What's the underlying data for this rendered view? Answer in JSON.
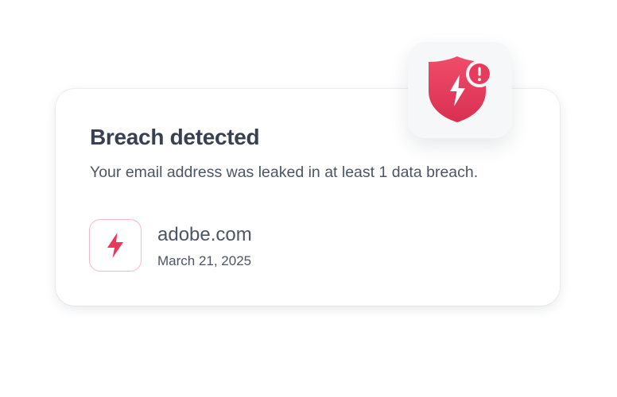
{
  "alert": {
    "title": "Breach detected",
    "message": "Your email address was leaked in at least 1 data breach."
  },
  "breaches": [
    {
      "site": "adobe.com",
      "date": "March 21, 2025",
      "icon": "lightning-icon"
    }
  ],
  "status_icon": {
    "icon": "shield-alert-icon",
    "badge_icon": "exclamation-icon"
  },
  "colors": {
    "accent": "#e83a5b",
    "accent_dark": "#d92f51",
    "text_heading": "#374151",
    "text_body": "#4b5563",
    "icon_border": "#f4b8c6"
  }
}
